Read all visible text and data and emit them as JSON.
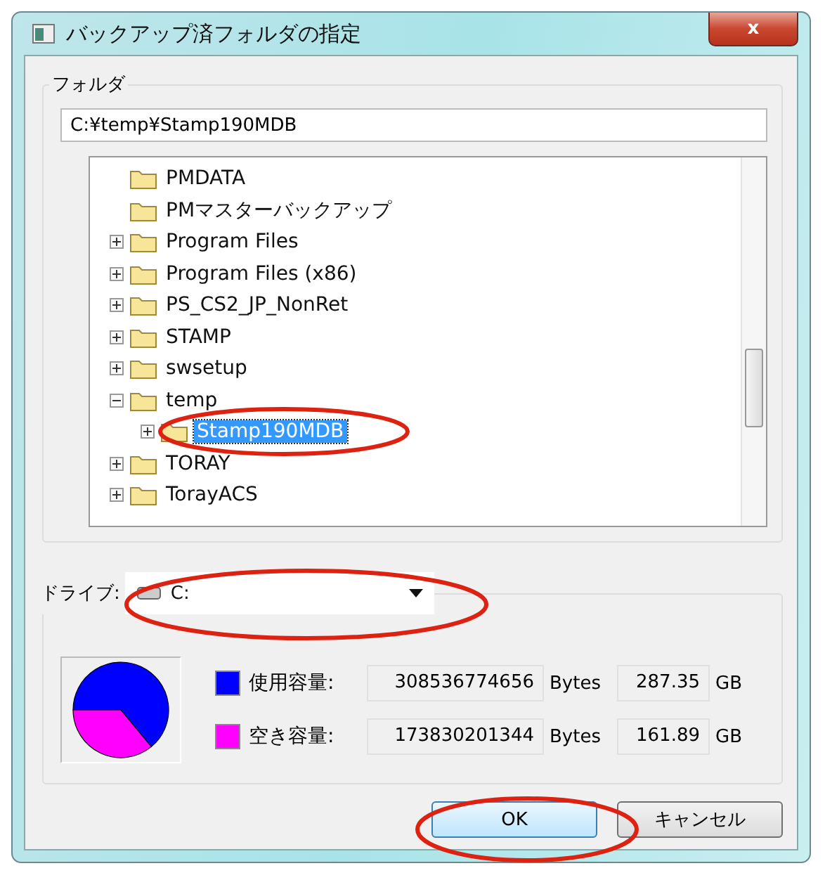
{
  "window": {
    "title": "バックアップ済フォルダの指定",
    "close": "x"
  },
  "folder": {
    "label": "フォルダ",
    "path": "C:¥temp¥Stamp190MDB",
    "tree": [
      {
        "label": "PMDATA",
        "has_children": false,
        "selected": false
      },
      {
        "label": "PMマスターバックアップ",
        "has_children": false,
        "selected": false
      },
      {
        "label": "Program Files",
        "has_children": true,
        "expanded": false,
        "selected": false
      },
      {
        "label": "Program Files (x86)",
        "has_children": true,
        "expanded": false,
        "selected": false
      },
      {
        "label": "PS_CS2_JP_NonRet",
        "has_children": true,
        "expanded": false,
        "selected": false
      },
      {
        "label": "STAMP",
        "has_children": true,
        "expanded": false,
        "selected": false
      },
      {
        "label": "swsetup",
        "has_children": true,
        "expanded": false,
        "selected": false
      },
      {
        "label": "temp",
        "has_children": true,
        "expanded": true,
        "selected": false,
        "children": [
          {
            "label": "Stamp190MDB",
            "has_children": true,
            "expanded": false,
            "selected": true
          }
        ]
      },
      {
        "label": "TORAY",
        "has_children": true,
        "expanded": false,
        "selected": false
      },
      {
        "label": "TorayACS",
        "has_children": true,
        "expanded": false,
        "selected": false
      }
    ]
  },
  "drive": {
    "label": "ドライブ:",
    "value": "C:",
    "legend": [
      {
        "label": "使用容量:",
        "bytes": "308536774656",
        "bytes_unit": "Bytes",
        "gb": "287.35",
        "gb_unit": "GB",
        "color": "#0000ff"
      },
      {
        "label": "空き容量:",
        "bytes": "173830201344",
        "bytes_unit": "Bytes",
        "gb": "161.89",
        "gb_unit": "GB",
        "color": "#ff00ff"
      }
    ]
  },
  "buttons": [
    {
      "label": "OK",
      "kind": "default"
    },
    {
      "label": "キャンセル",
      "kind": "normal"
    }
  ]
}
